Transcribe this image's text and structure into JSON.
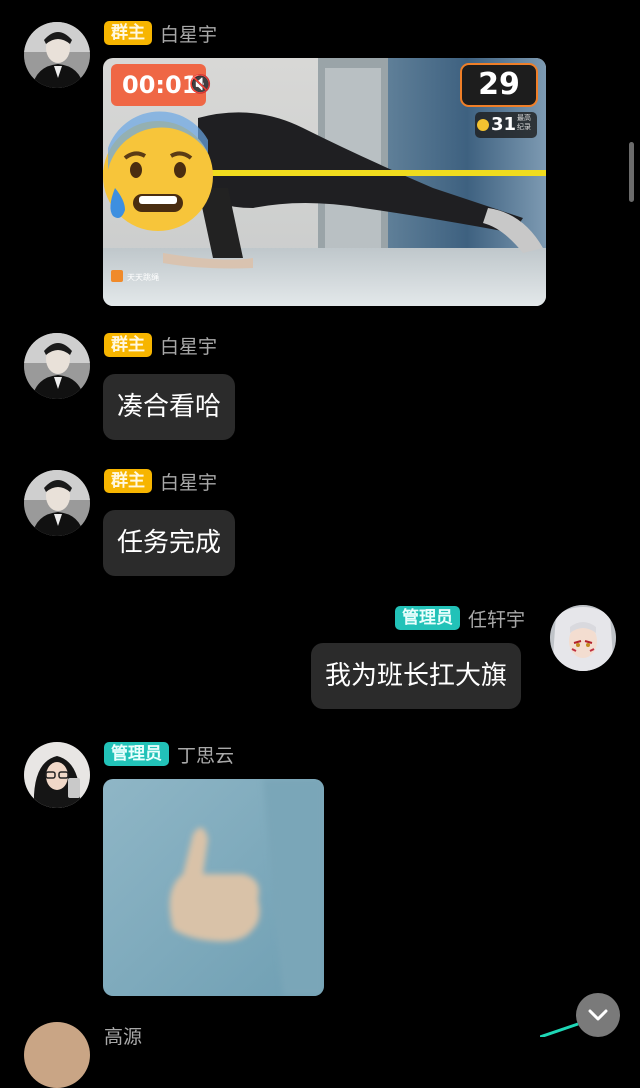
{
  "messages": [
    {
      "role_badge": "群主",
      "sender": "白星宇",
      "video": {
        "timer": "00:01",
        "counter": "29",
        "record_value": "31",
        "record_label_1": "最高",
        "record_label_2": "纪录",
        "app_watermark": "天天跳绳"
      }
    },
    {
      "role_badge": "群主",
      "sender": "白星宇",
      "text": "凑合看哈"
    },
    {
      "role_badge": "群主",
      "sender": "白星宇",
      "text": "任务完成"
    },
    {
      "role_badge": "管理员",
      "sender": "任轩宇",
      "text": "我为班长扛大旗"
    },
    {
      "role_badge": "管理员",
      "sender": "丁思云",
      "image": "thumbs-up-photo"
    },
    {
      "sender": "高源"
    }
  ],
  "colors": {
    "owner_badge": "#f7b500",
    "admin_badge": "#22c2b8",
    "bubble": "#2b2b2b",
    "background": "#000000"
  }
}
